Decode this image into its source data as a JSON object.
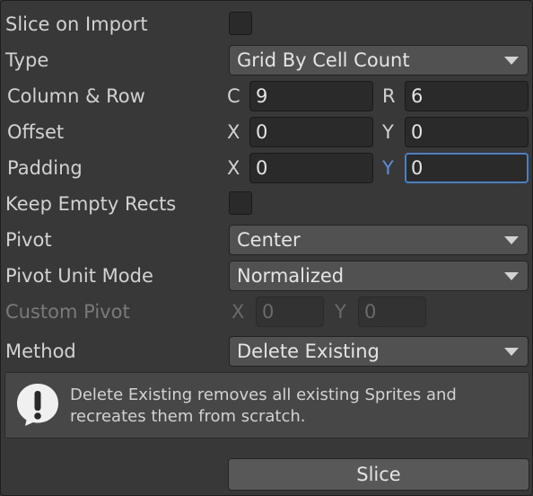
{
  "fields": {
    "slice_on_import": {
      "label": "Slice on Import",
      "checked": false
    },
    "type": {
      "label": "Type",
      "value": "Grid By Cell Count"
    },
    "column_row": {
      "label": "Column & Row",
      "c_label": "C",
      "c_value": "9",
      "r_label": "R",
      "r_value": "6"
    },
    "offset": {
      "label": "Offset",
      "x_label": "X",
      "x_value": "0",
      "y_label": "Y",
      "y_value": "0"
    },
    "padding": {
      "label": "Padding",
      "x_label": "X",
      "x_value": "0",
      "y_label": "Y",
      "y_value": "0"
    },
    "keep_empty_rects": {
      "label": "Keep Empty Rects",
      "checked": false
    },
    "pivot": {
      "label": "Pivot",
      "value": "Center"
    },
    "pivot_unit_mode": {
      "label": "Pivot Unit Mode",
      "value": "Normalized"
    },
    "custom_pivot": {
      "label": "Custom Pivot",
      "x_label": "X",
      "x_value": "0",
      "y_label": "Y",
      "y_value": "0",
      "disabled": true
    },
    "method": {
      "label": "Method",
      "value": "Delete Existing"
    }
  },
  "help": {
    "icon": "warning-exclamation-icon",
    "text": "Delete Existing removes all existing Sprites and recreates them from scratch."
  },
  "actions": {
    "slice_label": "Slice"
  },
  "colors": {
    "background": "#383838",
    "focus_accent": "#4a7fc1",
    "field_bg": "#2a2a2a",
    "dropdown_bg": "#515151"
  }
}
